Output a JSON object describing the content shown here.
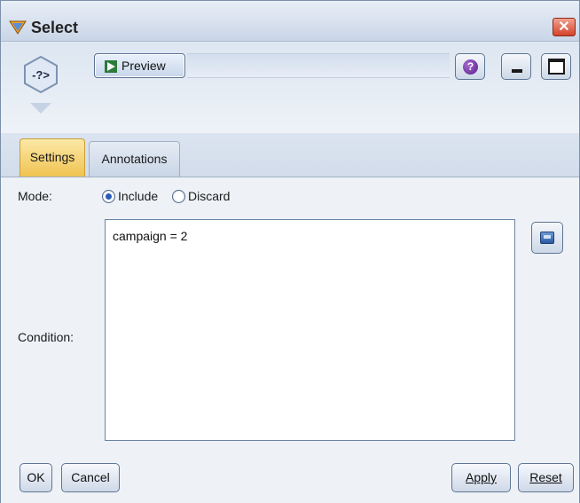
{
  "window": {
    "title": "Select",
    "close_glyph": "✕"
  },
  "header": {
    "preview_label": "Preview",
    "help_glyph": "?",
    "node_icon_text": "-?>"
  },
  "tabs": [
    {
      "label": "Settings",
      "selected": true
    },
    {
      "label": "Annotations",
      "selected": false
    }
  ],
  "settings": {
    "mode_label": "Mode:",
    "mode_options": [
      {
        "label": "Include",
        "checked": true
      },
      {
        "label": "Discard",
        "checked": false
      }
    ],
    "condition_label": "Condition:",
    "condition_value": "campaign = 2"
  },
  "buttons": {
    "ok": "OK",
    "cancel": "Cancel",
    "apply": "Apply",
    "reset": "Reset"
  },
  "colors": {
    "accent_tab": "#f0c352",
    "window_border": "#7a8fa8",
    "close_red": "#d4432b"
  }
}
